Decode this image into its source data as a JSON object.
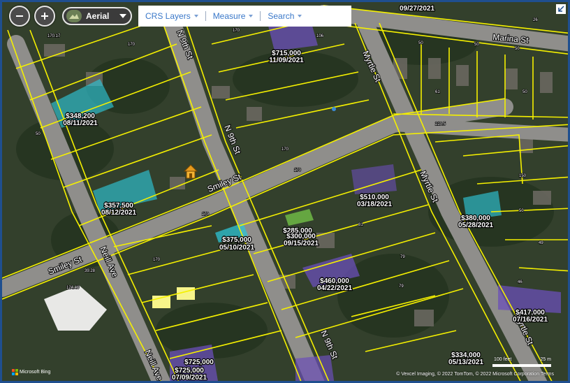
{
  "toolbar": {
    "basemap_label": "Aerial",
    "menus": [
      {
        "label": "CRS Layers"
      },
      {
        "label": "Measure"
      },
      {
        "label": "Search"
      }
    ]
  },
  "streets": [
    {
      "name": "N 9th St"
    },
    {
      "name": "N 9th St"
    },
    {
      "name": "N 9th St"
    },
    {
      "name": "Smiley St"
    },
    {
      "name": "Smiley St"
    },
    {
      "name": "Neill Ave"
    },
    {
      "name": "Neill Ave"
    },
    {
      "name": "Myrtle St"
    },
    {
      "name": "Myrtle St"
    },
    {
      "name": "Myrtle St"
    },
    {
      "name": "Marina St"
    }
  ],
  "sales": [
    {
      "price": "$715,000",
      "date": "11/09/2021"
    },
    {
      "price": "$348,200",
      "date": "08/11/2021"
    },
    {
      "price": "$357,500",
      "date": "08/12/2021"
    },
    {
      "price": "$510,000",
      "date": "03/18/2021"
    },
    {
      "price": "$285,000",
      "date": ""
    },
    {
      "price": "$300,000",
      "date": "09/15/2021"
    },
    {
      "price": "$375,000",
      "date": "05/10/2021"
    },
    {
      "price": "$460,000",
      "date": "04/22/2021"
    },
    {
      "price": "$380,000",
      "date": "05/28/2021"
    },
    {
      "price": "$417,000",
      "date": "07/16/2021"
    },
    {
      "price": "$334,000",
      "date": "05/13/2021"
    },
    {
      "price": "$725,000",
      "date": ""
    },
    {
      "price": "$725,000",
      "date": "07/09/2021"
    },
    {
      "price": "",
      "date": "09/27/2021"
    }
  ],
  "attribution": {
    "brand": "Microsoft Bing",
    "text": "© Vexcel Imaging, © 2022 TomTom, © 2022 Microsoft Corporation",
    "terms": "Terms"
  },
  "scale": {
    "left_label": "100 feet",
    "right_label": "25 m"
  },
  "colors": {
    "parcel_line": "#f5f000",
    "selected_sale": "#2ec4d6",
    "other_sale": "#6b4fb8",
    "frame": "#1f4f8f",
    "menu_text": "#3a78c9"
  }
}
